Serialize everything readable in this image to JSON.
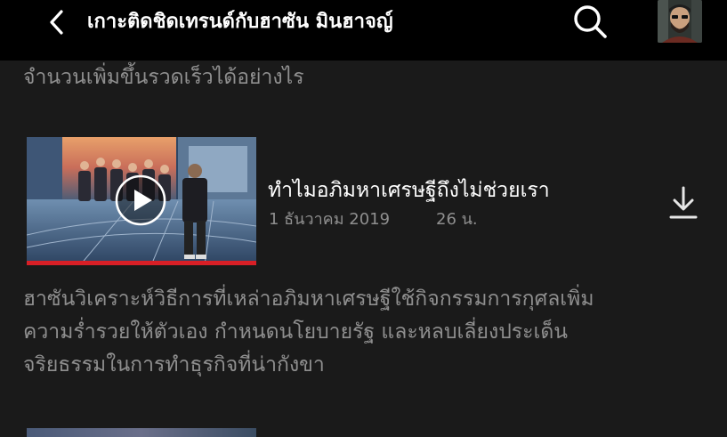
{
  "header": {
    "title": "เกาะติดชิดเทรนด์กับฮาซัน มินฮาจญ์",
    "back_icon": "chevron-left-icon",
    "search_icon": "search-icon",
    "profile_avatar": "profile-avatar"
  },
  "previous_episode": {
    "description_tail": "จำนวนเพิ่มขึ้นรวดเร็วได้อย่างไร"
  },
  "episode": {
    "title": "ทำไมอภิมหาเศรษฐีถึงไม่ช่วยเรา",
    "date": "1 ธันวาคม 2019",
    "duration": "26 น.",
    "watch_progress": 1.0,
    "description_lines": [
      "ฮาซันวิเคราะห์วิธีการที่เหล่าอภิมหาเศรษฐีใช้กิจกรรมการกุศลเพิ่ม",
      "ความร่ำรวยให้ตัวเอง กำหนดนโยบายรัฐ และหลบเลี่ยงประเด็น",
      "จริยธรรมในการทำธุรกิจที่น่ากังขา"
    ],
    "play_icon": "play-icon",
    "download_icon": "download-icon"
  },
  "colors": {
    "background": "#1a1a1a",
    "topbar": "#000000",
    "primary_text": "#ffffff",
    "secondary_text": "#8f8f8f",
    "progress": "#d81f26"
  }
}
